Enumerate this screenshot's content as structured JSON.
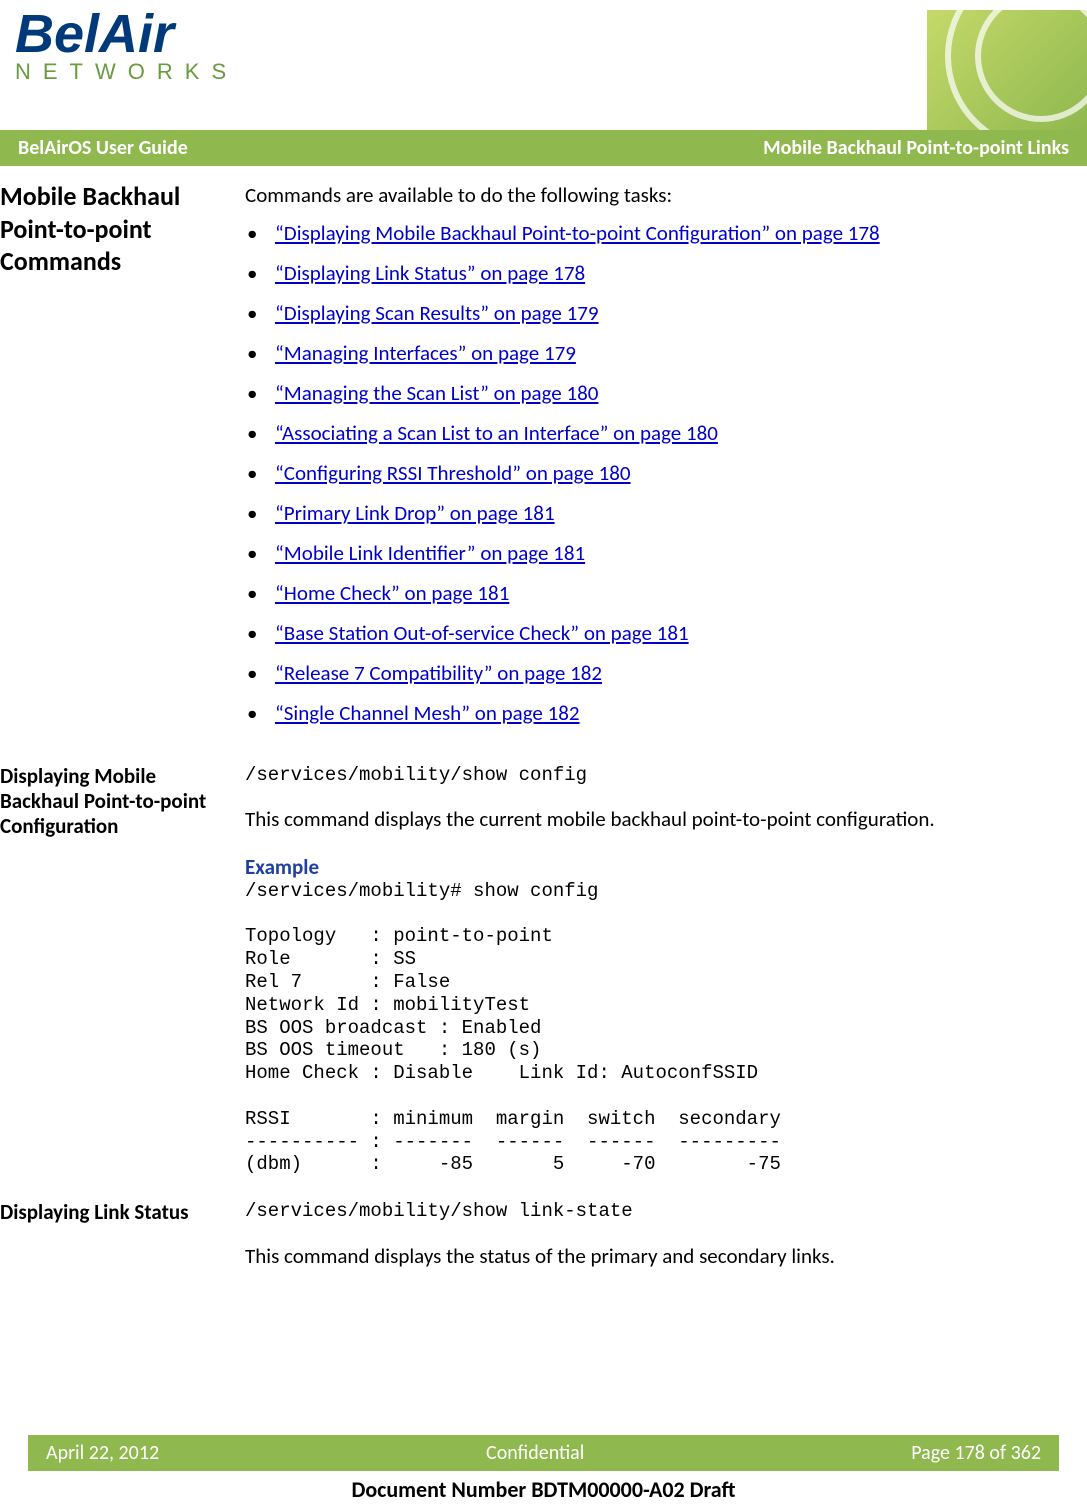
{
  "header": {
    "logo_main": "BelAir",
    "logo_sub": "NETWORKS"
  },
  "titlebar": {
    "left": "BelAirOS User Guide",
    "right": "Mobile Backhaul Point-to-point Links"
  },
  "section1": {
    "heading": "Mobile Backhaul Point-to-point Commands",
    "intro": "Commands are available to do the following tasks:",
    "links": [
      "“Displaying Mobile Backhaul Point-to-point Configuration” on page 178",
      "“Displaying Link Status” on page 178",
      "“Displaying Scan Results” on page 179",
      "“Managing Interfaces” on page 179",
      "“Managing the Scan List” on page 180",
      "“Associating a Scan List to an Interface” on page 180",
      "“Configuring RSSI Threshold” on page 180",
      "“Primary Link Drop” on page 181",
      "“Mobile Link Identifier” on page 181",
      "“Home Check” on page 181",
      "“Base Station Out-of-service Check” on page 181",
      "“Release 7 Compatibility” on page 182",
      "“Single Channel Mesh” on page 182"
    ]
  },
  "section2": {
    "heading": "Displaying Mobile Backhaul Point-to-point Configuration",
    "command": "/services/mobility/show config",
    "desc": "This command displays the current mobile backhaul point-to-point configuration.",
    "example_label": "Example",
    "example_body": "/services/mobility# show config\n\nTopology   : point-to-point\nRole       : SS\nRel 7      : False\nNetwork Id : mobilityTest\nBS OOS broadcast : Enabled\nBS OOS timeout   : 180 (s)\nHome Check : Disable    Link Id: AutoconfSSID\n\nRSSI       : minimum  margin  switch  secondary\n---------- : -------  ------  ------  ---------\n(dbm)      :     -85       5     -70        -75"
  },
  "section3": {
    "heading": "Displaying Link Status",
    "command": "/services/mobility/show link-state",
    "desc": "This command displays the status of the primary and secondary links."
  },
  "footer": {
    "date": "April 22, 2012",
    "confidential": "Confidential",
    "page": "Page 178 of 362",
    "docnum": "Document Number BDTM00000-A02 Draft"
  }
}
